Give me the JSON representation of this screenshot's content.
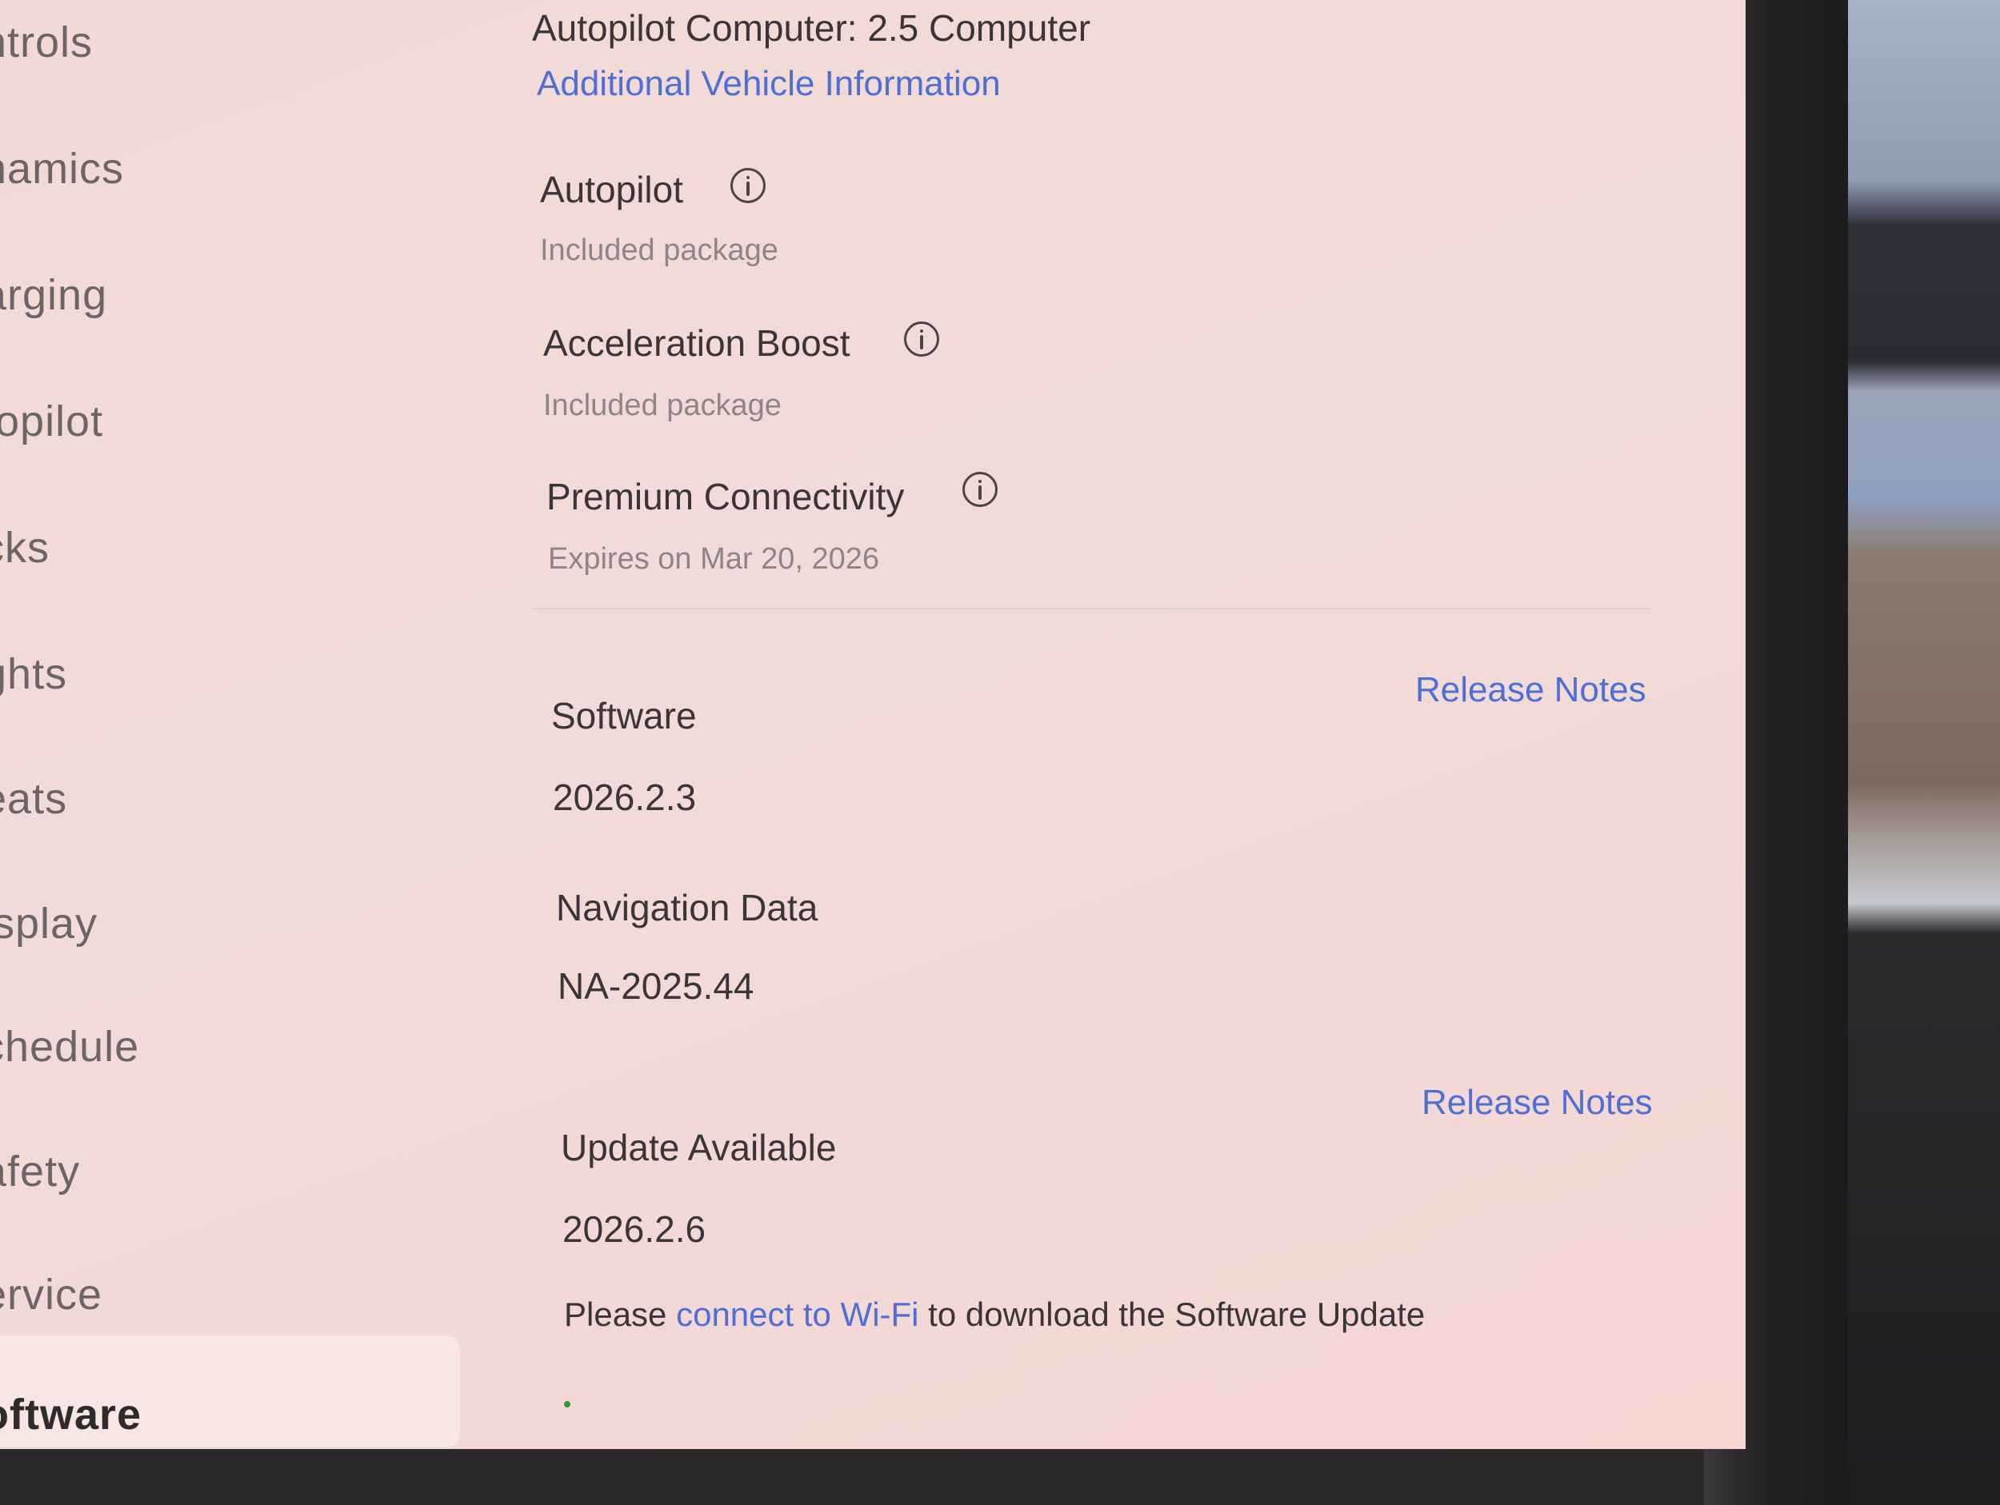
{
  "sidebar": {
    "items": [
      {
        "label": "ntrols"
      },
      {
        "label": "namics"
      },
      {
        "label": "arging"
      },
      {
        "label": "topilot"
      },
      {
        "label": "cks"
      },
      {
        "label": "ghts"
      },
      {
        "label": "eats"
      },
      {
        "label": "isplay"
      },
      {
        "label": "chedule"
      },
      {
        "label": "afety"
      },
      {
        "label": "ervice"
      },
      {
        "label": "oftware",
        "selected": true
      }
    ]
  },
  "vehicle": {
    "autopilot_computer": "Autopilot Computer: 2.5 Computer",
    "additional_info_link": "Additional Vehicle Information"
  },
  "features": [
    {
      "name": "Autopilot",
      "detail": "Included package",
      "icon": "info-icon"
    },
    {
      "name": "Acceleration Boost",
      "detail": "Included package",
      "icon": "info-icon"
    },
    {
      "name": "Premium Connectivity",
      "detail": "Expires on Mar 20, 2026",
      "icon": "info-icon"
    }
  ],
  "software": {
    "title": "Software",
    "version": "2026.2.3",
    "release_notes_label": "Release Notes"
  },
  "navigation_data": {
    "title": "Navigation Data",
    "version": "NA-2025.44"
  },
  "update": {
    "title": "Update Available",
    "version": "2026.2.6",
    "release_notes_label": "Release Notes",
    "message_prefix": "Please ",
    "message_link": "connect to Wi-Fi",
    "message_suffix": " to download the Software Update"
  },
  "colors": {
    "accent": "#4e6fd8",
    "screen_background": "#f2d9d6",
    "status_dot": "#2f9a3a"
  }
}
